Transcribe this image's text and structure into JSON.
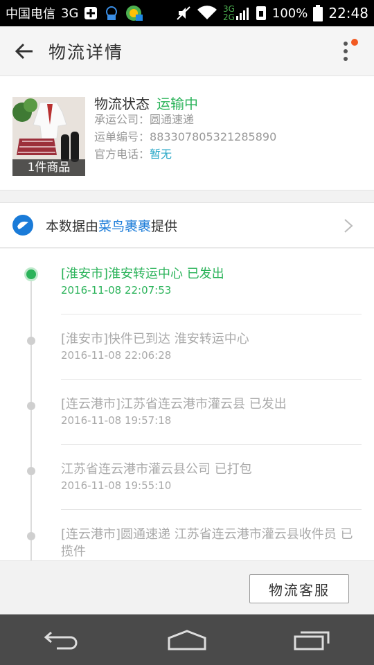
{
  "status_bar": {
    "carrier": "中国电信",
    "network": "3G",
    "network_small_1": "3G",
    "network_small_2": "2G",
    "battery": "100%",
    "time": "22:48"
  },
  "header": {
    "title": "物流详情"
  },
  "package": {
    "count_label": "1件商品",
    "status_label": "物流状态",
    "status_value": "运输中",
    "carrier_label": "承运公司：",
    "carrier_value": "圆通速递",
    "tracking_label": "运单编号：",
    "tracking_value": "883307805321285890",
    "phone_label": "官方电话：",
    "phone_value": "暂无"
  },
  "source": {
    "prefix": "本数据由",
    "link": "菜鸟裹裹",
    "suffix": "提供"
  },
  "timeline": [
    {
      "desc": "[淮安市]淮安转运中心 已发出",
      "time": "2016-11-08 22:07:53",
      "active": true
    },
    {
      "desc": "[淮安市]快件已到达 淮安转运中心",
      "time": "2016-11-08 22:06:28",
      "active": false
    },
    {
      "desc": "[连云港市]江苏省连云港市灌云县 已发出",
      "time": "2016-11-08 19:57:18",
      "active": false
    },
    {
      "desc": "江苏省连云港市灌云县公司 已打包",
      "time": "2016-11-08 19:55:10",
      "active": false
    },
    {
      "desc": "[连云港市]圆通速递 江苏省连云港市灌云县收件员 已揽件",
      "time": "",
      "active": false
    }
  ],
  "footer": {
    "service_button": "物流客服"
  },
  "colors": {
    "accent_green": "#2bb35a",
    "link_blue": "#1a7bd8",
    "badge_orange": "#f25a22"
  }
}
